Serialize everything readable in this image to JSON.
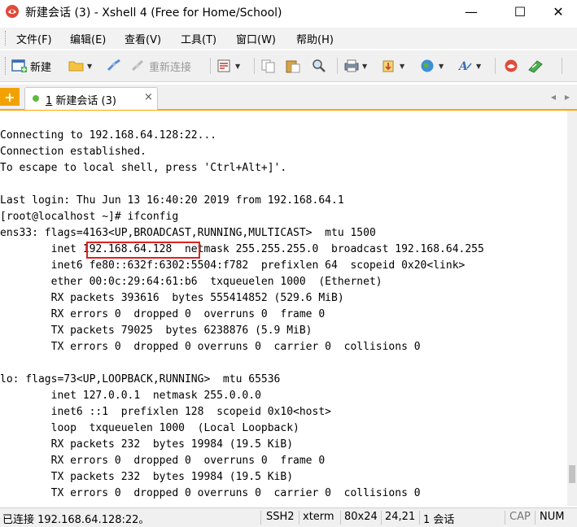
{
  "window": {
    "title": "新建会话 (3) - Xshell 4 (Free for Home/School)",
    "minimize_glyph": "—",
    "maximize_glyph": "☐",
    "close_glyph": "✕"
  },
  "menu": {
    "items": [
      "文件(F)",
      "编辑(E)",
      "查看(V)",
      "工具(T)",
      "窗口(W)",
      "帮助(H)"
    ]
  },
  "toolbar": {
    "new_label": "新建",
    "reconnect_label": "重新连接",
    "icons": [
      "new-session-icon",
      "open-folder-icon",
      "disconnect-icon",
      "reconnect-icon",
      "properties-icon",
      "copy-icon",
      "paste-icon",
      "find-icon",
      "print-icon",
      "transfer-icon",
      "globe-icon",
      "font-icon",
      "xshell-icon",
      "xftp-icon"
    ]
  },
  "tabs": {
    "plus_glyph": "+",
    "active": {
      "number": "1",
      "label": " 新建会话 (3)",
      "close_glyph": "×"
    },
    "scroll_left": "◀",
    "scroll_right": "▶"
  },
  "terminal": {
    "lines": [
      "",
      "Connecting to 192.168.64.128:22...",
      "Connection established.",
      "To escape to local shell, press 'Ctrl+Alt+]'.",
      "",
      "Last login: Thu Jun 13 16:40:20 2019 from 192.168.64.1",
      "[root@localhost ~]# ifconfig",
      "ens33: flags=4163<UP,BROADCAST,RUNNING,MULTICAST>  mtu 1500",
      "        inet 192.168.64.128  netmask 255.255.255.0  broadcast 192.168.64.255",
      "        inet6 fe80::632f:6302:5504:f782  prefixlen 64  scopeid 0x20<link>",
      "        ether 00:0c:29:64:61:b6  txqueuelen 1000  (Ethernet)",
      "        RX packets 393616  bytes 555414852 (529.6 MiB)",
      "        RX errors 0  dropped 0  overruns 0  frame 0",
      "        TX packets 79025  bytes 6238876 (5.9 MiB)",
      "        TX errors 0  dropped 0 overruns 0  carrier 0  collisions 0",
      "",
      "lo: flags=73<UP,LOOPBACK,RUNNING>  mtu 65536",
      "        inet 127.0.0.1  netmask 255.0.0.0",
      "        inet6 ::1  prefixlen 128  scopeid 0x10<host>",
      "        loop  txqueuelen 1000  (Local Loopback)",
      "        RX packets 232  bytes 19984 (19.5 KiB)",
      "        RX errors 0  dropped 0  overruns 0  frame 0",
      "        TX packets 232  bytes 19984 (19.5 KiB)",
      "        TX errors 0  dropped 0 overruns 0  carrier 0  collisions 0"
    ],
    "highlighted_ip": "192.168.64.128"
  },
  "status": {
    "connection": "已连接 192.168.64.128:22。",
    "protocol": "SSH2",
    "terminal_type": "xterm",
    "size": "80x24",
    "cursor": "24,21",
    "sessions": "1 会话",
    "caps": "CAP",
    "num": "NUM"
  },
  "colors": {
    "accent_orange": "#ffa500",
    "highlight_box": "#e02020",
    "tab_dot": "#5fb83a"
  }
}
